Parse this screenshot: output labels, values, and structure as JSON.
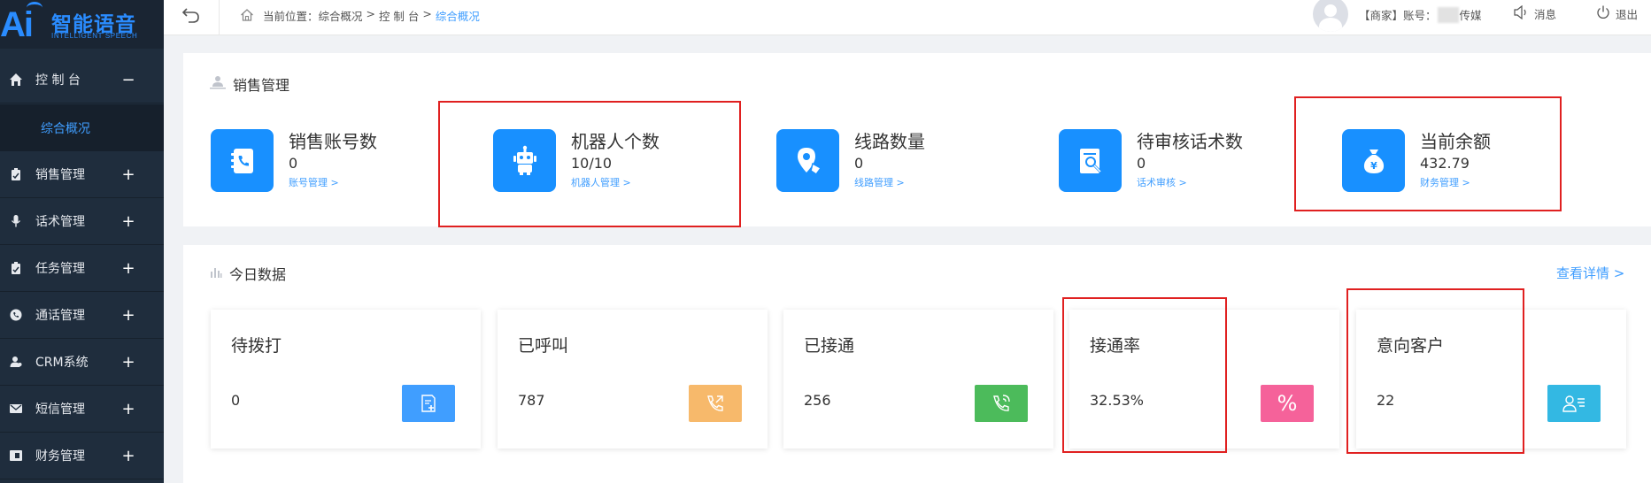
{
  "logo": {
    "ai": "Ai",
    "title": "智能语音",
    "subtitle": "INTELLIGENT SPEECH"
  },
  "sidebar": {
    "items": [
      {
        "label": "控 制 台",
        "toggle": "−",
        "icon": "home-icon"
      },
      {
        "label": "销售管理",
        "toggle": "+",
        "icon": "clipboard-icon"
      },
      {
        "label": "话术管理",
        "toggle": "+",
        "icon": "microphone-icon"
      },
      {
        "label": "任务管理",
        "toggle": "+",
        "icon": "task-icon"
      },
      {
        "label": "通话管理",
        "toggle": "+",
        "icon": "phone-icon"
      },
      {
        "label": "CRM系统",
        "toggle": "+",
        "icon": "user-icon"
      },
      {
        "label": "短信管理",
        "toggle": "+",
        "icon": "mail-icon"
      },
      {
        "label": "财务管理",
        "toggle": "+",
        "icon": "finance-icon"
      }
    ],
    "submenu_active": "综合概况"
  },
  "topbar": {
    "breadcrumb_prefix": "当前位置：",
    "breadcrumb": [
      "综合概况",
      " > ",
      "控 制 台",
      " > "
    ],
    "breadcrumb_active": "综合概况",
    "account_prefix": "【商家】账号：",
    "account_suffix": "传媒",
    "message": "消息",
    "logout": "退出"
  },
  "sales": {
    "title": "销售管理",
    "items": [
      {
        "label": "销售账号数",
        "value": "0",
        "link": "账号管理 >",
        "icon": "phone-book-icon"
      },
      {
        "label": "机器人个数",
        "value": "10/10",
        "link": "机器人管理 >",
        "icon": "robot-icon"
      },
      {
        "label": "线路数量",
        "value": "0",
        "link": "线路管理 >",
        "icon": "location-pin-icon"
      },
      {
        "label": "待审核话术数",
        "value": "0",
        "link": "话术审核 >",
        "icon": "document-search-icon"
      },
      {
        "label": "当前余额",
        "value": "432.79",
        "link": "财务管理 >",
        "icon": "money-bag-icon"
      }
    ]
  },
  "today": {
    "title": "今日数据",
    "view_more": "查看详情 >",
    "cards": [
      {
        "label": "待拨打",
        "value": "0",
        "icon": "document-add-icon",
        "color": "#409eff"
      },
      {
        "label": "已呼叫",
        "value": "787",
        "icon": "phone-outgoing-icon",
        "color": "#f7b96b"
      },
      {
        "label": "已接通",
        "value": "256",
        "icon": "phone-call-icon",
        "color": "#4cbb5b"
      },
      {
        "label": "接通率",
        "value": "32.53%",
        "icon": "percent-icon",
        "glyph": "%",
        "color": "#f5629a"
      },
      {
        "label": "意向客户",
        "value": "22",
        "icon": "contact-card-icon",
        "color": "#33b8e3"
      }
    ]
  },
  "colors": {
    "accent": "#409eff",
    "sidebar": "#1f2d3d",
    "highlight": "#e02020"
  }
}
